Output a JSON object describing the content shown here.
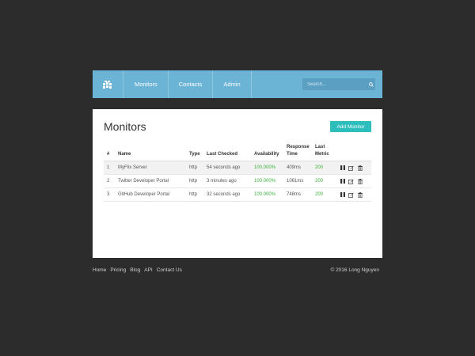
{
  "nav": {
    "items": [
      {
        "label": "Monitors"
      },
      {
        "label": "Contacts"
      },
      {
        "label": "Admin"
      }
    ],
    "search_placeholder": "Search...",
    "logo_icon": "stacked-cubes-icon",
    "search_icon": "search-icon"
  },
  "main": {
    "title": "Monitors",
    "add_button": "Add Monitor",
    "columns": [
      "#",
      "Name",
      "Type",
      "Last Checked",
      "Availability",
      "Response Time",
      "Last Metric"
    ],
    "rows": [
      {
        "num": "1",
        "name": "MyFlix Server",
        "type": "http",
        "last_checked": "54 seconds ago",
        "availability": "100.000%",
        "response_time": "409ms",
        "last_metric": "200"
      },
      {
        "num": "2",
        "name": "Twitter Developer Portal",
        "type": "http",
        "last_checked": "3 minutes ago",
        "availability": "100.000%",
        "response_time": "1061ms",
        "last_metric": "200"
      },
      {
        "num": "3",
        "name": "GitHub Developer Portal",
        "type": "http",
        "last_checked": "32 seconds ago",
        "availability": "100.000%",
        "response_time": "748ms",
        "last_metric": "200"
      }
    ],
    "row_actions": [
      "pause-icon",
      "edit-icon",
      "trash-icon"
    ]
  },
  "footer": {
    "links": [
      "Home",
      "Pricing",
      "Blog",
      "API",
      "Contact Us"
    ],
    "copyright": "© 2016 Long Nguyen"
  },
  "colors": {
    "background": "#2c2c2c",
    "navbar": "#6cb4d6",
    "accent_button": "#2cbdbd",
    "success_text": "#3ab03a"
  }
}
